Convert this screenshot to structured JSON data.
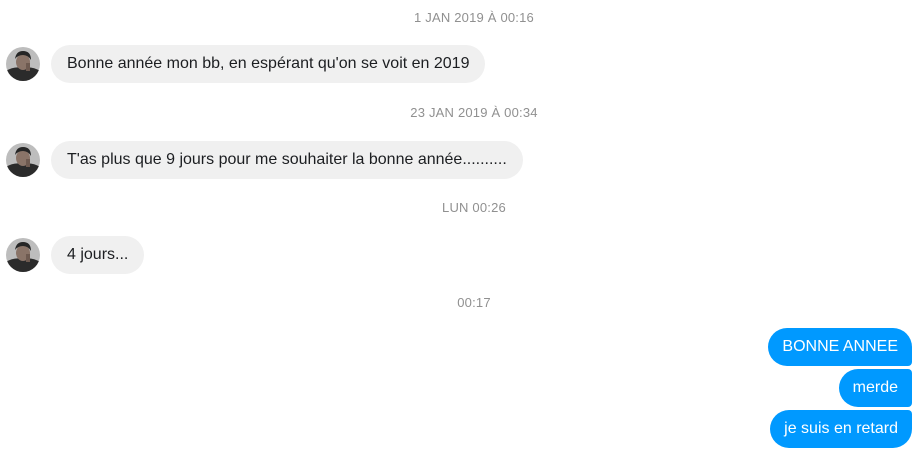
{
  "conversation": {
    "timestamps": [
      "1 JAN 2019 À 00:16",
      "23 JAN 2019 À 00:34",
      "LUN 00:26",
      "00:17"
    ],
    "incoming": [
      "Bonne année mon bb, en espérant qu'on se voit en 2019",
      "T'as plus que 9 jours pour me souhaiter la bonne année..........",
      "4 jours..."
    ],
    "outgoing": [
      "BONNE ANNEE",
      "merde",
      "je suis en retard"
    ]
  },
  "colors": {
    "incoming_bubble": "#f0f0f0",
    "outgoing_bubble": "#0099ff",
    "timestamp_text": "#909090"
  },
  "icons": {
    "contact_avatar": "avatar-icon"
  }
}
